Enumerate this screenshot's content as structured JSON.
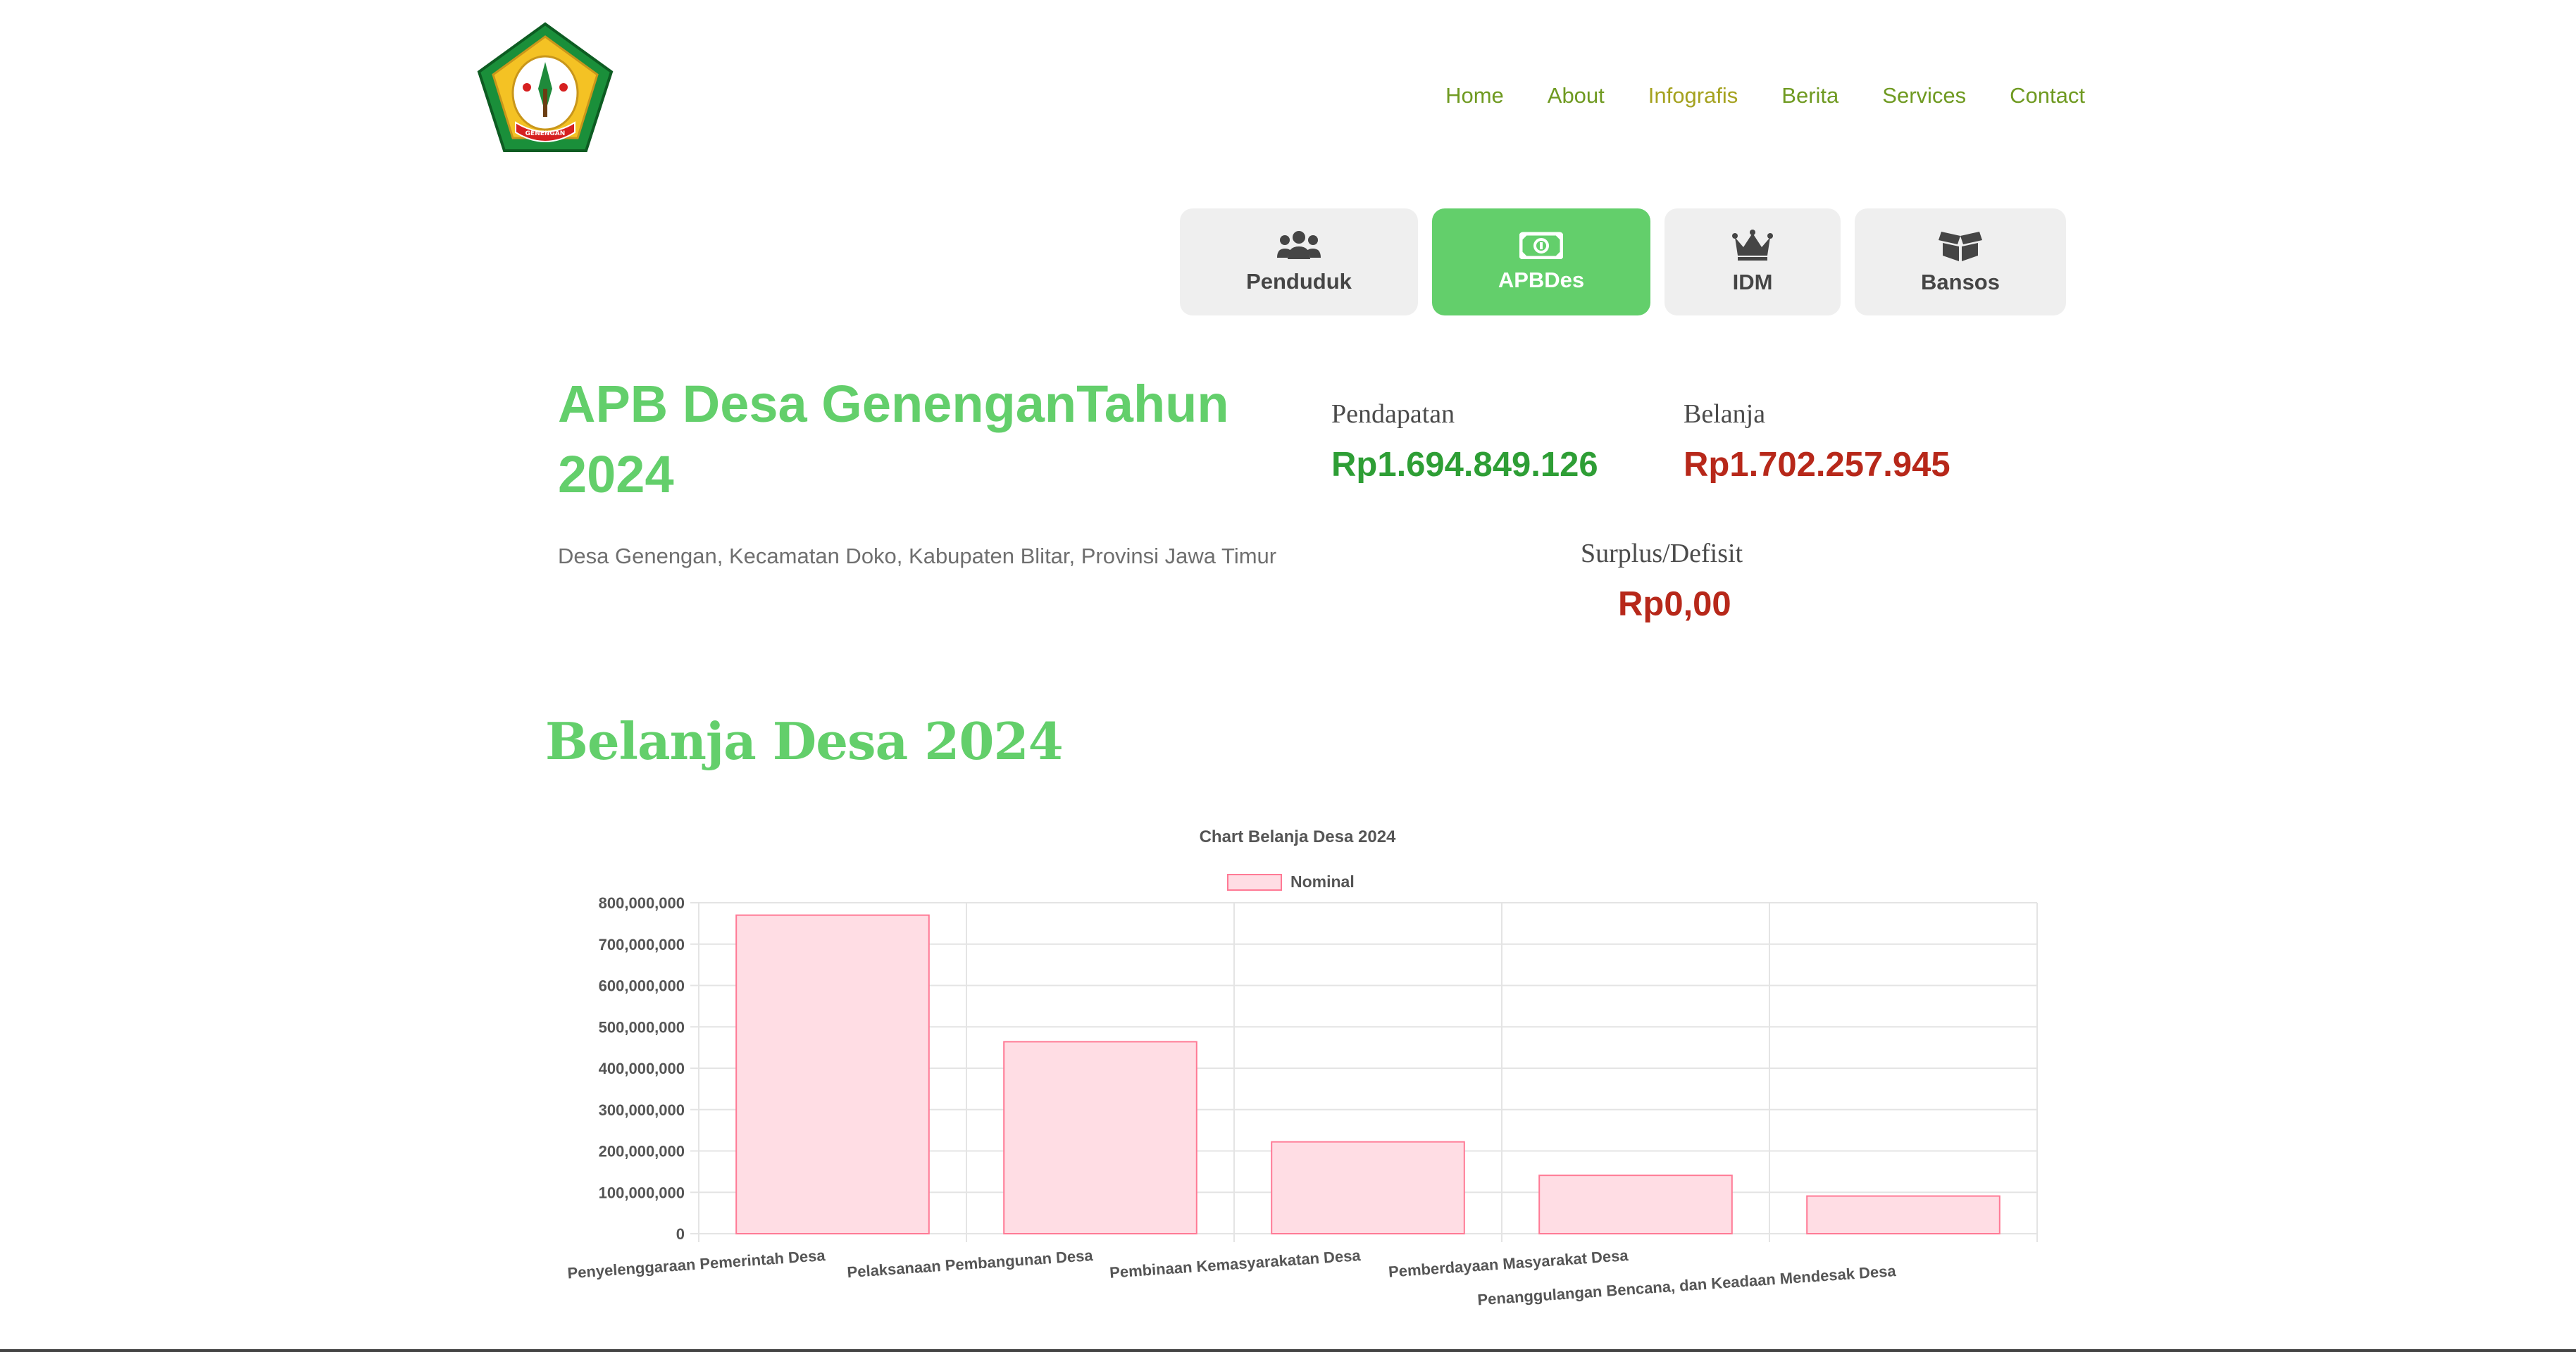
{
  "nav": {
    "items": [
      {
        "label": "Home",
        "name": "nav-home"
      },
      {
        "label": "About",
        "name": "nav-about"
      },
      {
        "label": "Infografis",
        "name": "nav-infografis",
        "active": true
      },
      {
        "label": "Berita",
        "name": "nav-berita"
      },
      {
        "label": "Services",
        "name": "nav-services"
      },
      {
        "label": "Contact",
        "name": "nav-contact"
      }
    ]
  },
  "tabs": [
    {
      "label": "Penduduk",
      "icon": "users-icon",
      "active": false
    },
    {
      "label": "APBDes",
      "icon": "money-bill-icon",
      "active": true
    },
    {
      "label": "IDM",
      "icon": "crown-icon",
      "active": false
    },
    {
      "label": "Bansos",
      "icon": "box-open-icon",
      "active": false
    }
  ],
  "header": {
    "title": "APB Desa GenenganTahun 2024",
    "subtitle": "Desa Genengan, Kecamatan Doko, Kabupaten Blitar, Provinsi Jawa Timur"
  },
  "summary": {
    "pendapatan_label": "Pendapatan",
    "pendapatan_value": "Rp1.694.849.126",
    "belanja_label": "Belanja",
    "belanja_value": "Rp1.702.257.945",
    "surplus_label": "Surplus/Defisit",
    "surplus_value": "Rp0,00"
  },
  "section": {
    "title": "Belanja Desa 2024"
  },
  "colors": {
    "accent": "#63cf6b",
    "nav": "#6f9a21",
    "pendapatan": "#2e9e35",
    "belanja": "#b7281a",
    "bar_fill": "#ffdde4",
    "bar_stroke": "#ff7a95"
  },
  "logo": {
    "text": "GENENGAN"
  },
  "chart_data": {
    "type": "bar",
    "title": "Chart Belanja Desa 2024",
    "legend": "Nominal",
    "legend_position": "top",
    "categories": [
      "Penyelenggaraan Pemerintah Desa",
      "Pelaksanaan Pembangunan Desa",
      "Pembinaan Kemasyarakatan Desa",
      "Pemberdayaan Masyarakat Desa",
      "Penanggulangan Bencana, dan Keadaan Mendesak Desa"
    ],
    "series": [
      {
        "name": "Nominal",
        "values": [
          770000000,
          464000000,
          222000000,
          141000000,
          91000000
        ]
      }
    ],
    "ylim": [
      0,
      800000000
    ],
    "yticks": [
      0,
      100000000,
      200000000,
      300000000,
      400000000,
      500000000,
      600000000,
      700000000,
      800000000
    ],
    "ytick_labels": [
      "0",
      "100,000,000",
      "200,000,000",
      "300,000,000",
      "400,000,000",
      "500,000,000",
      "600,000,000",
      "700,000,000",
      "800,000,000"
    ],
    "grid": true,
    "xlabel": "",
    "ylabel": ""
  }
}
